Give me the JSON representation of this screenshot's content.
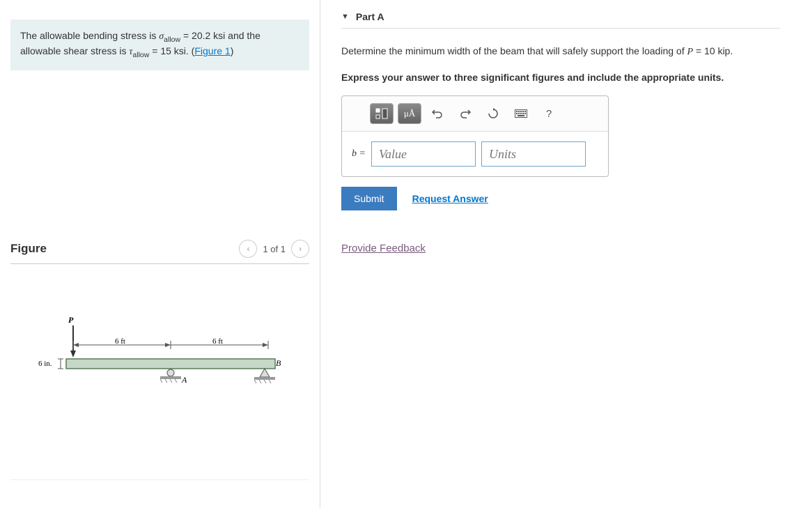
{
  "problem": {
    "intro_a": "The allowable bending stress is ",
    "sigma_sym": "σ",
    "allow_sub": "allow",
    "sigma_val": " = 20.2  ksi",
    "intro_b": " and the allowable shear stress is ",
    "tau_sym": "τ",
    "tau_val": " = 15 ksi",
    "period_open": ". (",
    "figure_link": "Figure 1",
    "close_paren": ")"
  },
  "figure": {
    "title": "Figure",
    "page": "1 of 1",
    "labels": {
      "P": "P",
      "span1": "6 ft",
      "span2": "6 ft",
      "depth": "6 in.",
      "A": "A",
      "B": "B"
    }
  },
  "partA": {
    "title": "Part A",
    "question_a": "Determine the minimum width of the beam that will safely support the loading of ",
    "P_sym": "P",
    "P_val": " = 10 kip",
    "q_end": ".",
    "instruction": "Express your answer to three significant figures and include the appropriate units.",
    "toolbar": {
      "units_btn": "μÅ",
      "help": "?"
    },
    "answer": {
      "var": "b = ",
      "value_ph": "Value",
      "units_ph": "Units"
    },
    "submit": "Submit",
    "request": "Request Answer"
  },
  "feedback": "Provide Feedback"
}
